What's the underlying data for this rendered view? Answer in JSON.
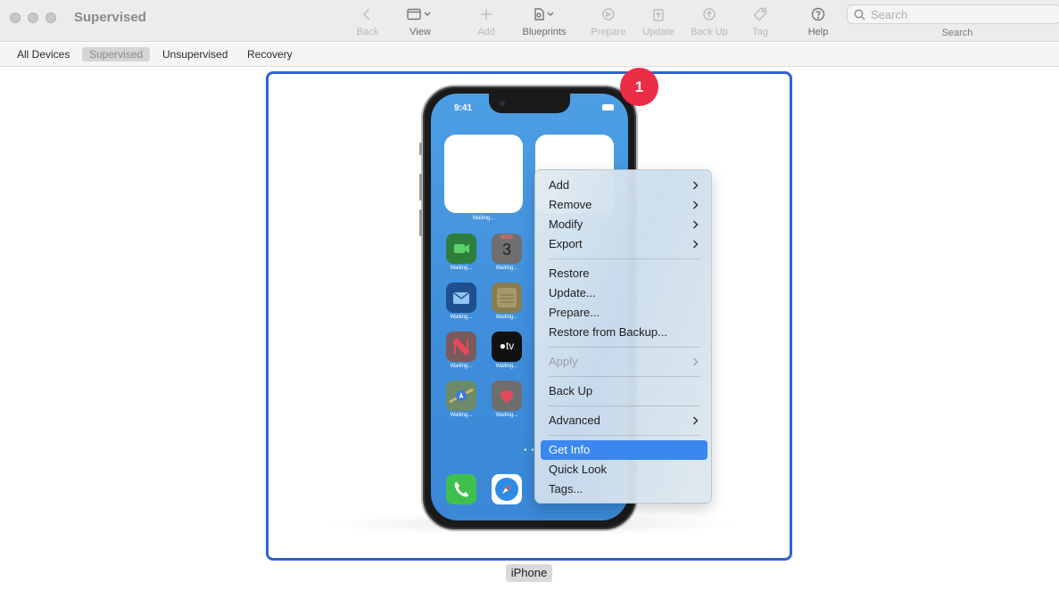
{
  "window": {
    "title": "Supervised"
  },
  "toolbar": {
    "items": [
      {
        "label": "Back",
        "icon": "chevron-left-icon"
      },
      {
        "label": "View",
        "icon": "window-view-icon"
      },
      {
        "label": "Add",
        "icon": "plus-icon"
      },
      {
        "label": "Blueprints",
        "icon": "blueprint-icon"
      },
      {
        "label": "Prepare",
        "icon": "prepare-icon"
      },
      {
        "label": "Update",
        "icon": "update-icon"
      },
      {
        "label": "Back Up",
        "icon": "backup-icon"
      },
      {
        "label": "Tag",
        "icon": "tag-icon"
      },
      {
        "label": "Help",
        "icon": "help-icon"
      }
    ],
    "search": {
      "placeholder": "Search",
      "label": "Search"
    }
  },
  "scope_bar": {
    "items": [
      "All Devices",
      "Supervised",
      "Unsupervised",
      "Recovery"
    ],
    "selected": "Supervised"
  },
  "device": {
    "name": "iPhone",
    "badge_count": "1",
    "status_time": "9:41",
    "widget_label": "Waiting...",
    "app_label": "Waiting...",
    "calendar_day": "WED",
    "calendar_date": "3"
  },
  "context_menu": {
    "items": [
      {
        "label": "Add",
        "submenu": true
      },
      {
        "label": "Remove",
        "submenu": true
      },
      {
        "label": "Modify",
        "submenu": true
      },
      {
        "label": "Export",
        "submenu": true
      },
      {
        "label": "Restore"
      },
      {
        "label": "Update..."
      },
      {
        "label": "Prepare..."
      },
      {
        "label": "Restore from Backup..."
      },
      {
        "label": "Apply",
        "submenu": true,
        "disabled": true
      },
      {
        "label": "Back Up"
      },
      {
        "label": "Advanced",
        "submenu": true
      },
      {
        "label": "Get Info",
        "highlighted": true
      },
      {
        "label": "Quick Look"
      },
      {
        "label": "Tags..."
      }
    ]
  },
  "colors": {
    "accent": "#3a87f0",
    "selection_border": "#2d64d4",
    "badge": "#ec2d46"
  }
}
